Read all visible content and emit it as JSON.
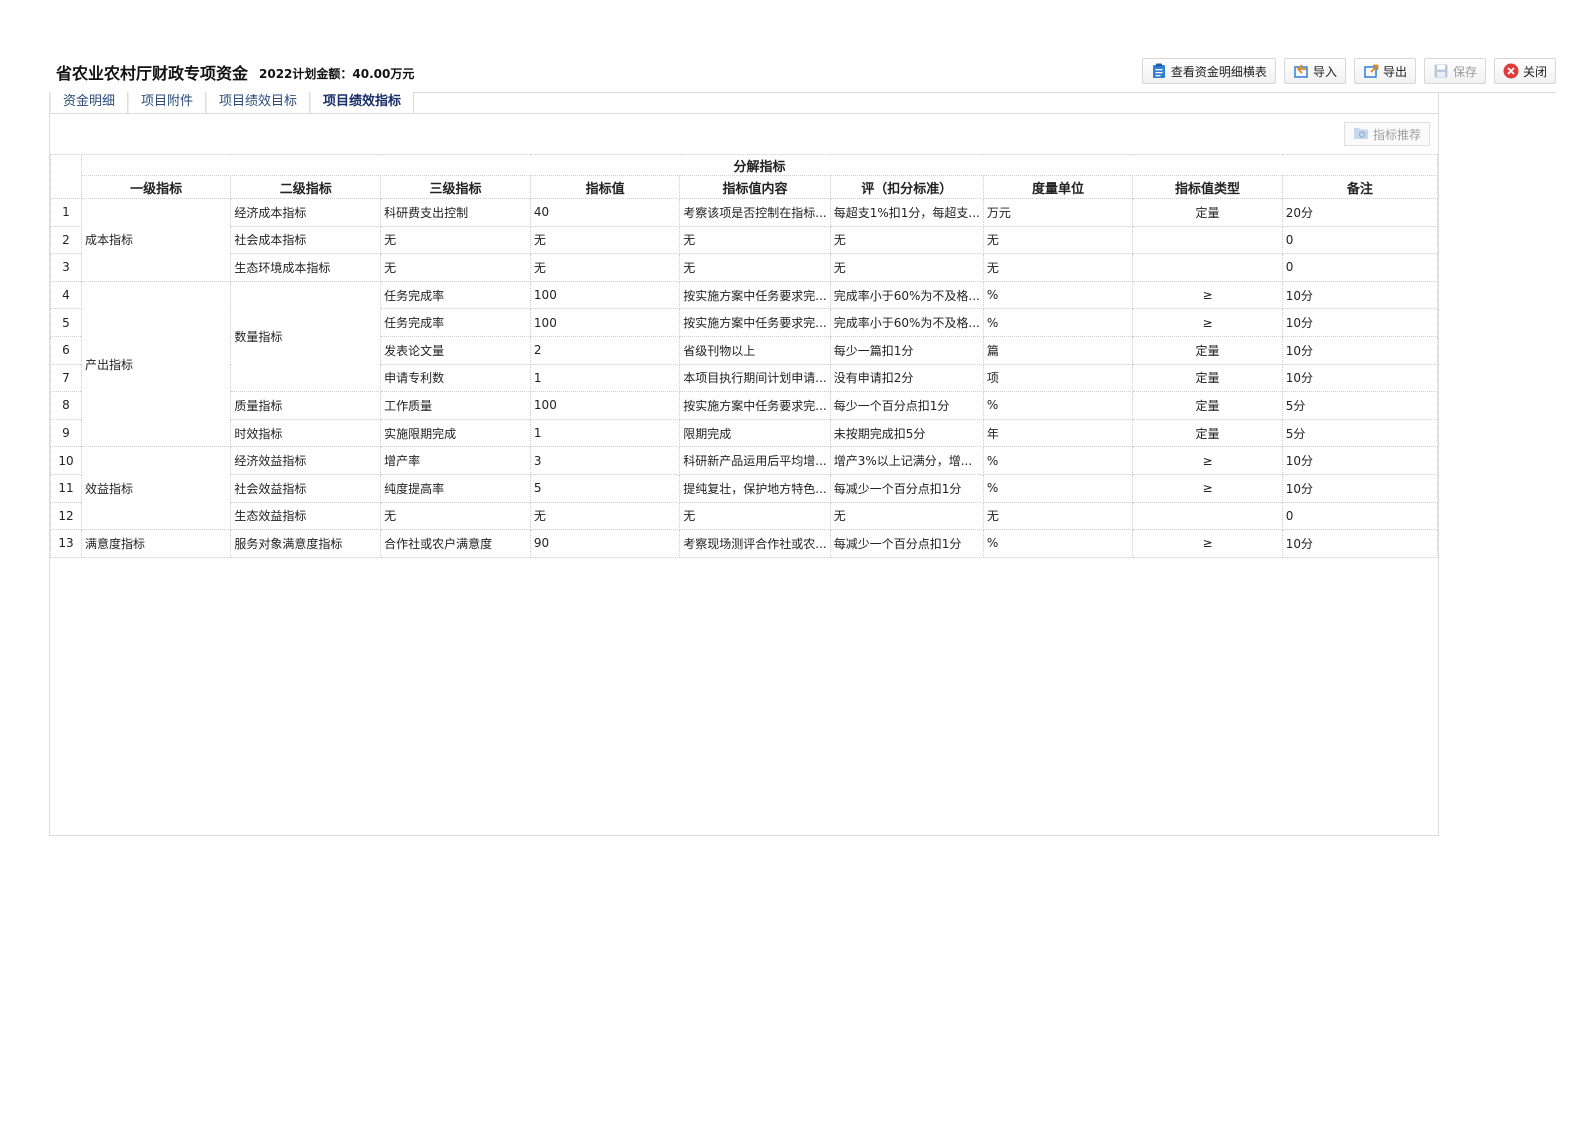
{
  "header": {
    "title": "省农业农村厅财政专项资金",
    "plan_amount": "2022计划金额：40.00万元"
  },
  "toolbar": {
    "view_detail": "查看资金明细横表",
    "import": "导入",
    "export": "导出",
    "save": "保存",
    "close": "关闭"
  },
  "tabs": [
    "资金明细",
    "项目附件",
    "项目绩效目标",
    "项目绩效指标"
  ],
  "active_tab": 3,
  "recommend_button": "指标推荐",
  "table": {
    "group_header": "分解指标",
    "columns": [
      "一级指标",
      "二级指标",
      "三级指标",
      "指标值",
      "指标值内容",
      "评（扣分标准）",
      "度量单位",
      "指标值类型",
      "备注"
    ],
    "level1": [
      {
        "label": "成本指标",
        "rows": 3
      },
      {
        "label": "产出指标",
        "rows": 6
      },
      {
        "label": "效益指标",
        "rows": 3
      },
      {
        "label": "满意度指标",
        "rows": 1
      }
    ],
    "level2": [
      {
        "label": "经济成本指标",
        "rows": 1
      },
      {
        "label": "社会成本指标",
        "rows": 1
      },
      {
        "label": "生态环境成本指标",
        "rows": 1
      },
      {
        "label": "数量指标",
        "rows": 4
      },
      {
        "label": "质量指标",
        "rows": 1
      },
      {
        "label": "时效指标",
        "rows": 1
      },
      {
        "label": "经济效益指标",
        "rows": 1
      },
      {
        "label": "社会效益指标",
        "rows": 1
      },
      {
        "label": "生态效益指标",
        "rows": 1
      },
      {
        "label": "服务对象满意度指标",
        "rows": 1
      }
    ],
    "rows": [
      {
        "n": "1",
        "l3": "科研费支出控制",
        "val": "40",
        "content": "考察该项是否控制在指标...",
        "std": "每超支1%扣1分，每超支...",
        "unit": "万元",
        "type": "定量",
        "note": "20分"
      },
      {
        "n": "2",
        "l3": "无",
        "val": "无",
        "content": "无",
        "std": "无",
        "unit": "无",
        "type": "",
        "note": "0"
      },
      {
        "n": "3",
        "l3": "无",
        "val": "无",
        "content": "无",
        "std": "无",
        "unit": "无",
        "type": "",
        "note": "0"
      },
      {
        "n": "4",
        "l3": "任务完成率",
        "val": "100",
        "content": "按实施方案中任务要求完...",
        "std": "完成率小于60%为不及格...",
        "unit": "%",
        "type": "≥",
        "note": "10分"
      },
      {
        "n": "5",
        "l3": "任务完成率",
        "val": "100",
        "content": "按实施方案中任务要求完...",
        "std": "完成率小于60%为不及格...",
        "unit": "%",
        "type": "≥",
        "note": "10分"
      },
      {
        "n": "6",
        "l3": "发表论文量",
        "val": "2",
        "content": "省级刊物以上",
        "std": "每少一篇扣1分",
        "unit": "篇",
        "type": "定量",
        "note": "10分"
      },
      {
        "n": "7",
        "l3": "申请专利数",
        "val": "1",
        "content": "本项目执行期间计划申请...",
        "std": "没有申请扣2分",
        "unit": "项",
        "type": "定量",
        "note": "10分"
      },
      {
        "n": "8",
        "l3": "工作质量",
        "val": "100",
        "content": "按实施方案中任务要求完...",
        "std": "每少一个百分点扣1分",
        "unit": "%",
        "type": "定量",
        "note": "5分"
      },
      {
        "n": "9",
        "l3": "实施限期完成",
        "val": "1",
        "content": "限期完成",
        "std": "未按期完成扣5分",
        "unit": "年",
        "type": "定量",
        "note": "5分"
      },
      {
        "n": "10",
        "l3": "增产率",
        "val": "3",
        "content": "科研新产品运用后平均增...",
        "std": "增产3%以上记满分，增...",
        "unit": "%",
        "type": "≥",
        "note": "10分"
      },
      {
        "n": "11",
        "l3": "纯度提高率",
        "val": "5",
        "content": "提纯复壮，保护地方特色...",
        "std": "每减少一个百分点扣1分",
        "unit": "%",
        "type": "≥",
        "note": "10分"
      },
      {
        "n": "12",
        "l3": "无",
        "val": "无",
        "content": "无",
        "std": "无",
        "unit": "无",
        "type": "",
        "note": "0"
      },
      {
        "n": "13",
        "l3": "合作社或农户满意度",
        "val": "90",
        "content": "考察现场测评合作社或农...",
        "std": "每减少一个百分点扣1分",
        "unit": "%",
        "type": "≥",
        "note": "10分"
      }
    ]
  },
  "colors": {
    "accent_blue": "#2f7fd6",
    "close_red": "#e03b3b",
    "tab_text": "#2a4a7a",
    "border": "#cfcfcf"
  },
  "icons": {
    "view_detail": "clipboard-icon",
    "import": "import-icon",
    "export": "export-icon",
    "save": "floppy-icon",
    "close": "close-circle-icon",
    "recommend": "folder-icon"
  }
}
